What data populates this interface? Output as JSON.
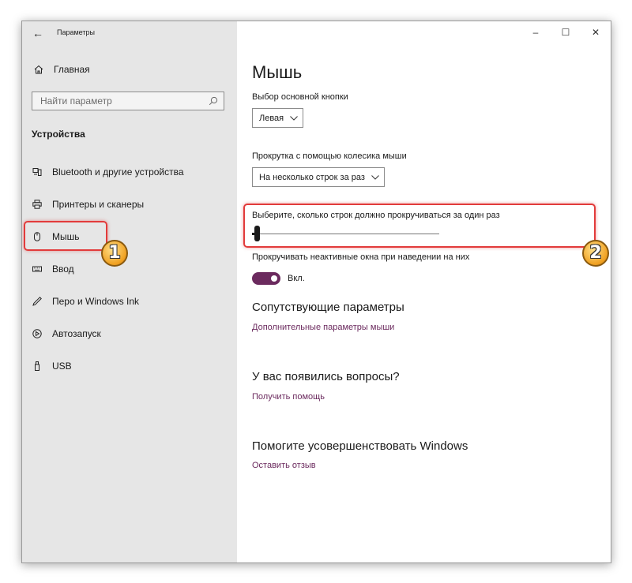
{
  "window": {
    "title": "Параметры",
    "controls": {
      "minimize": "–",
      "maximize": "☐",
      "close": "✕"
    }
  },
  "sidebar": {
    "home_label": "Главная",
    "search_placeholder": "Найти параметр",
    "section_heading": "Устройства",
    "items": [
      {
        "label": "Bluetooth и другие устройства",
        "icon": "bluetooth-devices-icon"
      },
      {
        "label": "Принтеры и сканеры",
        "icon": "printer-icon"
      },
      {
        "label": "Мышь",
        "icon": "mouse-icon",
        "selected": true
      },
      {
        "label": "Ввод",
        "icon": "keyboard-icon"
      },
      {
        "label": "Перо и Windows Ink",
        "icon": "pen-icon"
      },
      {
        "label": "Автозапуск",
        "icon": "autoplay-icon"
      },
      {
        "label": "USB",
        "icon": "usb-icon"
      }
    ]
  },
  "main": {
    "title": "Мышь",
    "primary_button": {
      "label": "Выбор основной кнопки",
      "value": "Левая"
    },
    "wheel_scroll": {
      "label": "Прокрутка с помощью колесика мыши",
      "value": "На несколько строк за раз"
    },
    "lines_slider": {
      "label": "Выберите, сколько строк должно прокручиваться за один раз",
      "fraction": 0.03
    },
    "inactive_scroll": {
      "label": "Прокручивать неактивные окна при наведении на них",
      "state": "Вкл.",
      "on": true
    },
    "related": {
      "heading": "Сопутствующие параметры",
      "link": "Дополнительные параметры мыши"
    },
    "questions": {
      "heading": "У вас появились вопросы?",
      "link": "Получить помощь"
    },
    "feedback": {
      "heading": "Помогите усовершенствовать Windows",
      "link": "Оставить отзыв"
    }
  },
  "callouts": {
    "first": "1",
    "second": "2"
  },
  "colors": {
    "accent": "#6b2a5e",
    "callout": "#e23b3b",
    "sidebar_bg": "#e6e6e6"
  }
}
